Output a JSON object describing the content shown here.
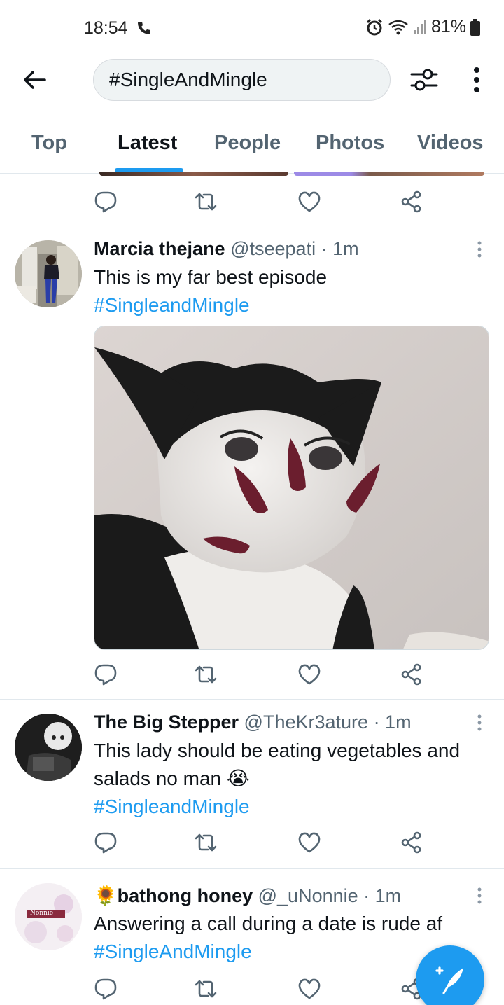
{
  "status_bar": {
    "time": "18:54",
    "battery": "81%"
  },
  "header": {
    "search_value": "#SingleAndMingle"
  },
  "tabs": [
    {
      "label": "Top"
    },
    {
      "label": "Latest"
    },
    {
      "label": "People"
    },
    {
      "label": "Photos"
    },
    {
      "label": "Videos"
    }
  ],
  "active_tab": "Latest",
  "tweets": [
    {
      "name": "Marcia thejane",
      "handle": "@tseepati",
      "time": "· 1m",
      "text": "This is my far best episode",
      "hashtag": "#SingleandMingle"
    },
    {
      "name": "The Big Stepper",
      "handle": "@TheKr3ature",
      "time": "· 1m",
      "text": "This lady should be eating vegetables and salads no man",
      "emoji": "😭",
      "hashtag": "#SingleandMingle"
    },
    {
      "name_emoji": "🌻",
      "name": "bathong honey",
      "handle": "@_uNonnie",
      "time": "· 1m",
      "text": "Answering a call during a date is rude af",
      "hashtag": "#SingleAndMingle",
      "avatar_label": "Nonnie"
    }
  ],
  "colors": {
    "accent": "#1d9bf0",
    "text_secondary": "#536471"
  },
  "icons": [
    "back-arrow-icon",
    "search-filter-icon",
    "overflow-menu-icon",
    "reply-icon",
    "retweet-icon",
    "like-icon",
    "share-icon",
    "compose-tweet-icon"
  ]
}
